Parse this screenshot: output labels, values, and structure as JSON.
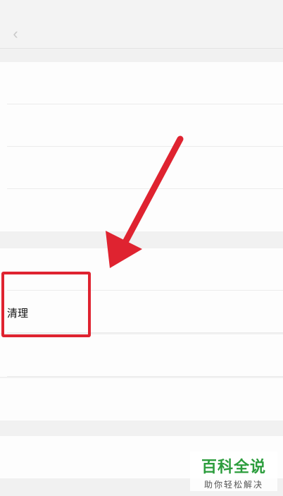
{
  "status_bar": {
    "carrier": "",
    "time": "",
    "battery": ""
  },
  "nav": {
    "title": "",
    "back_icon": "chevron-left-icon"
  },
  "settings_rows": [
    {
      "label": "",
      "value": ""
    },
    {
      "label": "",
      "value": ""
    },
    {
      "label": "",
      "value": ""
    },
    {
      "label": "",
      "value": ""
    },
    {
      "label": "",
      "value": ""
    },
    {
      "label": "清理",
      "value": ""
    },
    {
      "label": "",
      "value": ""
    },
    {
      "label": "",
      "value": ""
    },
    {
      "label": "",
      "value": ""
    }
  ],
  "annotation": {
    "highlight_color": "#df2330",
    "arrow_icon": "red-arrow-icon"
  },
  "watermark": {
    "title": "百科全说",
    "subtitle": "助你轻松解决",
    "color": "#2c9d3d"
  }
}
